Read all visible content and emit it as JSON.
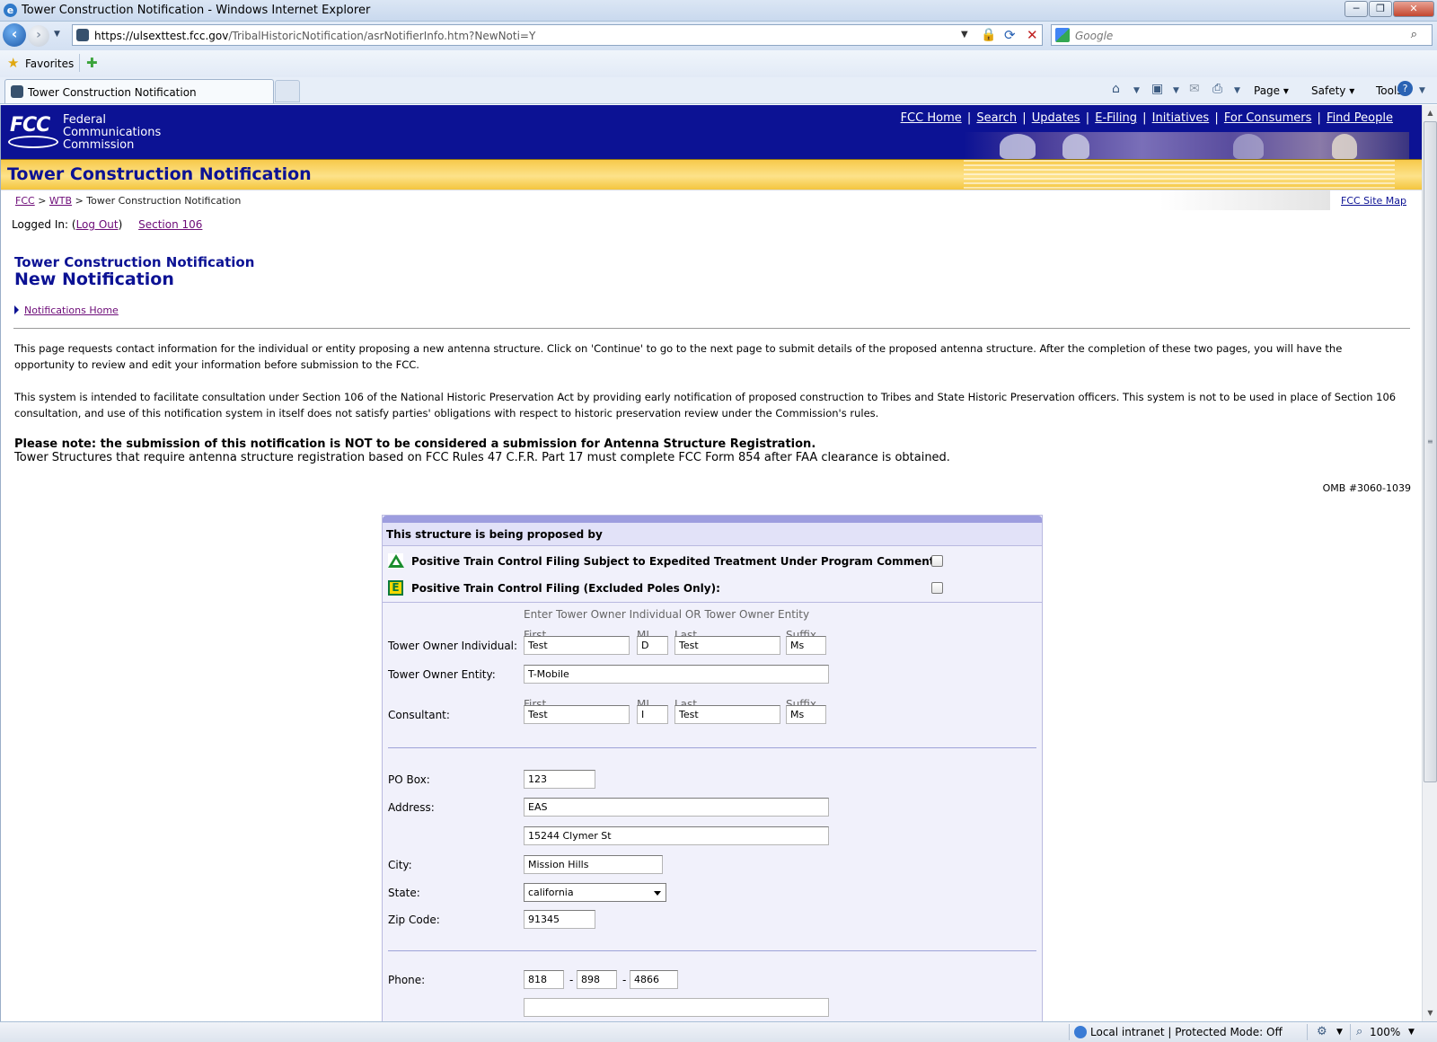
{
  "window": {
    "title": "Tower Construction Notification - Windows Internet Explorer",
    "ie_logo": "e",
    "minimize": "─",
    "maximize": "❐",
    "close": "✕"
  },
  "nav": {
    "back_icon": "arrow-left-icon",
    "url_host": "https://ulsexttest.fcc.gov",
    "url_path": "/TribalHistoricNotification/asrNotifierInfo.htm?NewNoti=Y",
    "search_placeholder": "Google"
  },
  "favorites": {
    "label": "Favorites"
  },
  "tab": {
    "title": "Tower Construction Notification"
  },
  "commands": {
    "page": "Page ▾",
    "safety": "Safety ▾",
    "tools": "Tools ▾"
  },
  "fcc": {
    "logo": "FCC",
    "name_lines": [
      "Federal",
      "Communications",
      "Commission"
    ],
    "top_links": [
      "FCC Home",
      "Search",
      "Updates",
      "E-Filing",
      "Initiatives",
      "For Consumers",
      "Find People"
    ],
    "strip_title": "Tower Construction Notification"
  },
  "breadcrumb": {
    "fcc": "FCC",
    "sep": " > ",
    "wtb": "WTB",
    "current": "Tower Construction Notification",
    "site_map": "FCC Site Map"
  },
  "login": {
    "logged_in": "Logged In:",
    "open_paren": "(",
    "logout": "Log Out",
    "close_paren": ")",
    "section106": "Section 106"
  },
  "page": {
    "heading1": "Tower Construction Notification",
    "heading2": "New Notification",
    "notifications_home": "Notifications Home",
    "para1": "This page requests contact information for the individual or entity proposing a new antenna structure. Click on 'Continue' to go to the next page to submit details of the proposed antenna structure. After the completion of these two pages, you will have the opportunity to review and edit your information before submission to the FCC.",
    "para2": "This system is intended to facilitate consultation under Section 106 of the National Historic Preservation Act by providing early notification of proposed construction to Tribes and State Historic Preservation officers. This system is not to be used in place of Section 106 consultation, and use of this notification system in itself does not satisfy parties' obligations with respect to historic preservation review under the Commission's rules.",
    "note_bold": "Please note: the submission of this notification is NOT to be considered a submission for Antenna Structure Registration.",
    "note_text": "Tower Structures that require antenna structure registration based on FCC Rules 47 C.F.R. Part 17 must complete FCC Form 854 after FAA clearance is obtained.",
    "omb": "OMB #3060-1039"
  },
  "form": {
    "caption": "This structure is being proposed by",
    "ptc_expedited_label": "Positive Train Control Filing Subject to Expedited Treatment Under Program Comment:",
    "ptc_expedited_checked": false,
    "ptc_excluded_label": "Positive Train Control Filing (Excluded Poles Only):",
    "ptc_excluded_checked": false,
    "ptc_excluded_badge": "E",
    "hint": "Enter Tower Owner Individual OR Tower Owner Entity",
    "sub": {
      "first": "First",
      "mi": "MI",
      "last": "Last",
      "suffix": "Suffix"
    },
    "owner_individual_label": "Tower Owner Individual:",
    "owner_individual": {
      "first": "Test",
      "mi": "D",
      "last": "Test",
      "suffix": "Ms"
    },
    "owner_entity_label": "Tower Owner Entity:",
    "owner_entity": "T-Mobile",
    "consultant_label": "Consultant:",
    "consultant": {
      "first": "Test",
      "mi": "I",
      "last": "Test",
      "suffix": "Ms"
    },
    "po_box_label": "PO Box:",
    "po_box": "123",
    "address_label": "Address:",
    "address1": "EAS",
    "address2": "15244 Clymer St",
    "city_label": "City:",
    "city": "Mission Hills",
    "state_label": "State:",
    "state": "california",
    "zip_label": "Zip Code:",
    "zip": "91345",
    "phone_label": "Phone:",
    "phone": [
      "818",
      "898",
      "4866"
    ],
    "phone_dash": "-"
  },
  "status": {
    "zone": "Local intranet | Protected Mode: Off",
    "zoom": "100%"
  }
}
